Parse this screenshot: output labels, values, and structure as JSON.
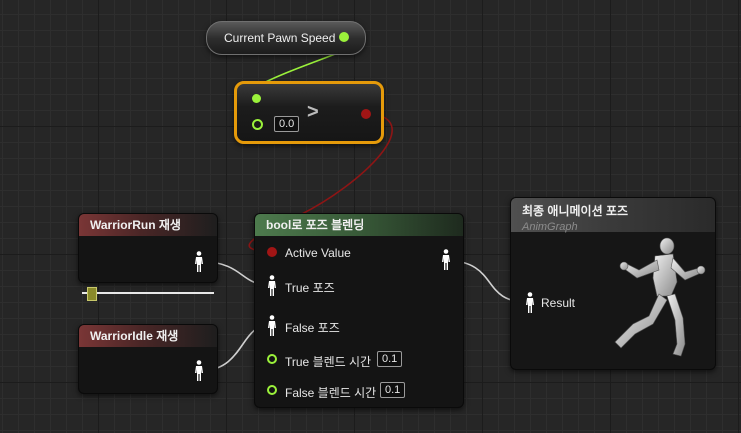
{
  "variable_node": {
    "label": "Current Pawn Speed"
  },
  "compare_node": {
    "operator": ">",
    "input_value": "0.0"
  },
  "run_node": {
    "title": "WarriorRun 재생"
  },
  "idle_node": {
    "title": "WarriorIdle 재생"
  },
  "blend_node": {
    "title": "bool로 포즈 블렌딩",
    "active_value_label": "Active Value",
    "true_pose_label": "True 포즈",
    "false_pose_label": "False 포즈",
    "true_blend_time_label": "True 블렌드 시간",
    "true_blend_time_value": "0.1",
    "false_blend_time_label": "False 블렌드 시간",
    "false_blend_time_value": "0.1"
  },
  "output_node": {
    "title": "최종 애니메이션 포즈",
    "subtitle": "AnimGraph",
    "result_label": "Result"
  },
  "colors": {
    "float_pin": "#9bf23b",
    "bool_pin": "#a11515",
    "selection_border": "#e59a0a",
    "pose_pin": "#ffffff"
  },
  "icons": {
    "pose_pin": "person-icon",
    "float_pin": "circle-pin-icon",
    "bool_pin": "circle-pin-icon"
  }
}
